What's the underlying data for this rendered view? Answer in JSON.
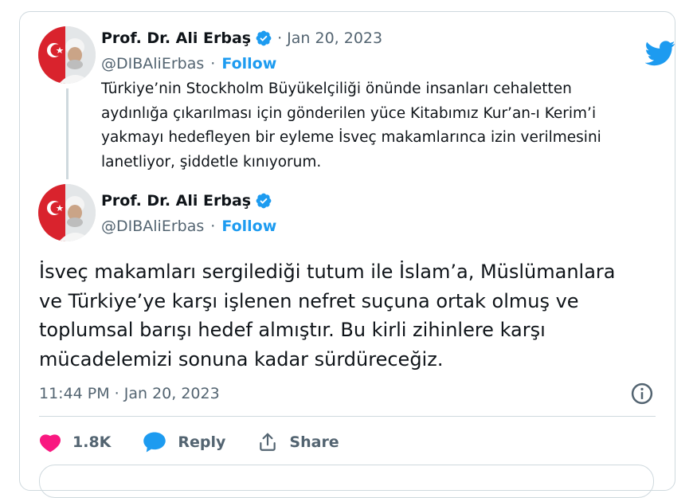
{
  "quoted_tweet": {
    "author_name": "Prof. Dr. Ali Erbaş",
    "handle": "@DIBAliErbas",
    "separator": "·",
    "follow_label": "Follow",
    "date": "Jan 20, 2023",
    "text": "Türkiye’nin Stockholm Büyükelçiliği önünde insanları cehaletten aydınlığa çıkarılması için gönderilen yüce Kitabımız Kur’an-ı Kerim’i yakmayı hedefleyen bir eyleme İsveç makamlarınca izin verilmesini lanetliyor, şiddetle kınıyorum."
  },
  "main_tweet": {
    "author_name": "Prof. Dr. Ali Erbaş",
    "handle": "@DIBAliErbas",
    "separator": "·",
    "follow_label": "Follow",
    "text": "İsveç makamları sergilediği tutum ile İslam’a, Müslümanlara ve Türkiye’ye karşı işlenen nefret suçuna ortak olmuş ve toplumsal barışı hedef almıştır. Bu kirli zihinlere karşı mücadelemizi sonuna kadar sürdüreceğiz.",
    "timestamp": "11:44 PM · Jan 20, 2023"
  },
  "actions": {
    "like_count": "1.8K",
    "reply_label": "Reply",
    "share_label": "Share"
  },
  "icons": {
    "brand": "twitter-bird-icon",
    "verified": "verified-badge-icon",
    "info": "info-icon",
    "like": "heart-icon",
    "reply": "speech-bubble-icon",
    "share": "share-arrow-icon"
  },
  "colors": {
    "brand_blue": "#1d9bf0",
    "like_pink": "#f91880",
    "muted_text": "#536471",
    "border": "#cfd9de"
  }
}
